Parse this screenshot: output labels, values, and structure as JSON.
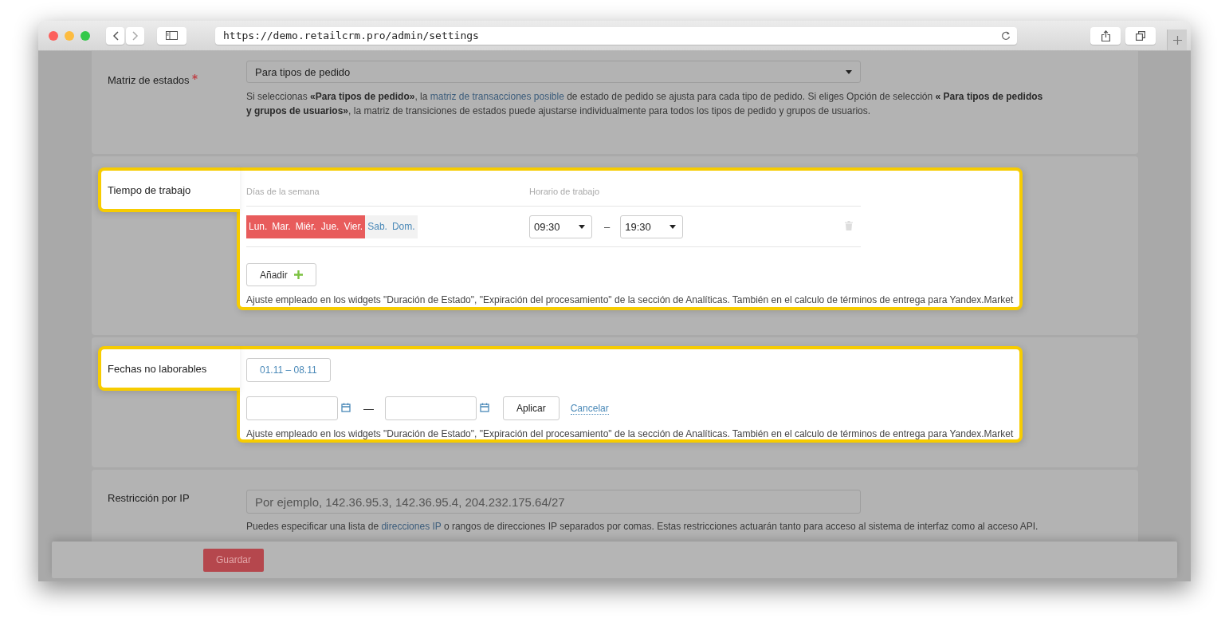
{
  "browser": {
    "url": "https://demo.retailcrm.pro/admin/settings"
  },
  "sections": [
    {
      "kind": "select",
      "highlighted": false,
      "label": "Matriz de estados",
      "required": true,
      "value": "Para tipos de pedido",
      "help": [
        {
          "text": "Si seleccionas **«Para tipos de pedido»**, la "
        },
        {
          "text": "matriz de transacciones posible",
          "link": true
        },
        {
          "text": " de estado de pedido se ajusta para cada tipo de pedido. Si eliges Opción de selección **« Para tipos de pedidos y grupos de usuarios»**, la matriz de transiciones de estados puede ajustarse individualmente para todos los tipos de pedido y grupos de usuarios."
        }
      ]
    },
    {
      "kind": "schedule",
      "highlighted": true,
      "label": "Tiempo de trabajo",
      "columns": [
        "Días de la semana",
        "Horario de trabajo"
      ],
      "rows": [
        {
          "days": [
            {
              "label": "Lun.",
              "selected": true
            },
            {
              "label": "Mar.",
              "selected": true
            },
            {
              "label": "Miér.",
              "selected": true
            },
            {
              "label": "Jue.",
              "selected": true
            },
            {
              "label": "Vier.",
              "selected": true
            },
            {
              "label": "Sab.",
              "selected": false
            },
            {
              "label": "Dom.",
              "selected": false
            }
          ],
          "from": "09:30",
          "separator": "–",
          "to": "19:30"
        }
      ],
      "add_button": "Añadir",
      "note": "Ajuste empleado en los widgets \"Duración de Estado\", \"Expiración del procesamiento\" de la sección de Analíticas. También en el calculo de términos de entrega para Yandex.Market"
    },
    {
      "kind": "dates",
      "highlighted": true,
      "label": "Fechas no laborables",
      "ranges": [
        "01.11 – 08.11"
      ],
      "separator": "—",
      "apply_button": "Aplicar",
      "cancel_link": "Cancelar",
      "note": "Ajuste empleado en los widgets \"Duración de Estado\", \"Expiración del procesamiento\" de la sección de Analíticas. También en el calculo de términos de entrega para Yandex.Market"
    },
    {
      "kind": "text",
      "highlighted": false,
      "label": "Restricción por IP",
      "placeholder": "Por ejemplo, 142.36.95.3, 142.36.95.4, 204.232.175.64/27",
      "help": [
        {
          "text": "Puedes especificar una lista de "
        },
        {
          "text": "direcciones IP",
          "link": true
        },
        {
          "text": " o rangos de direcciones IP separados por comas. Estas restricciones actuarán tanto para acceso al sistema de interfaz como al acceso API."
        }
      ]
    }
  ],
  "footer": {
    "save_button": "Guardar"
  }
}
